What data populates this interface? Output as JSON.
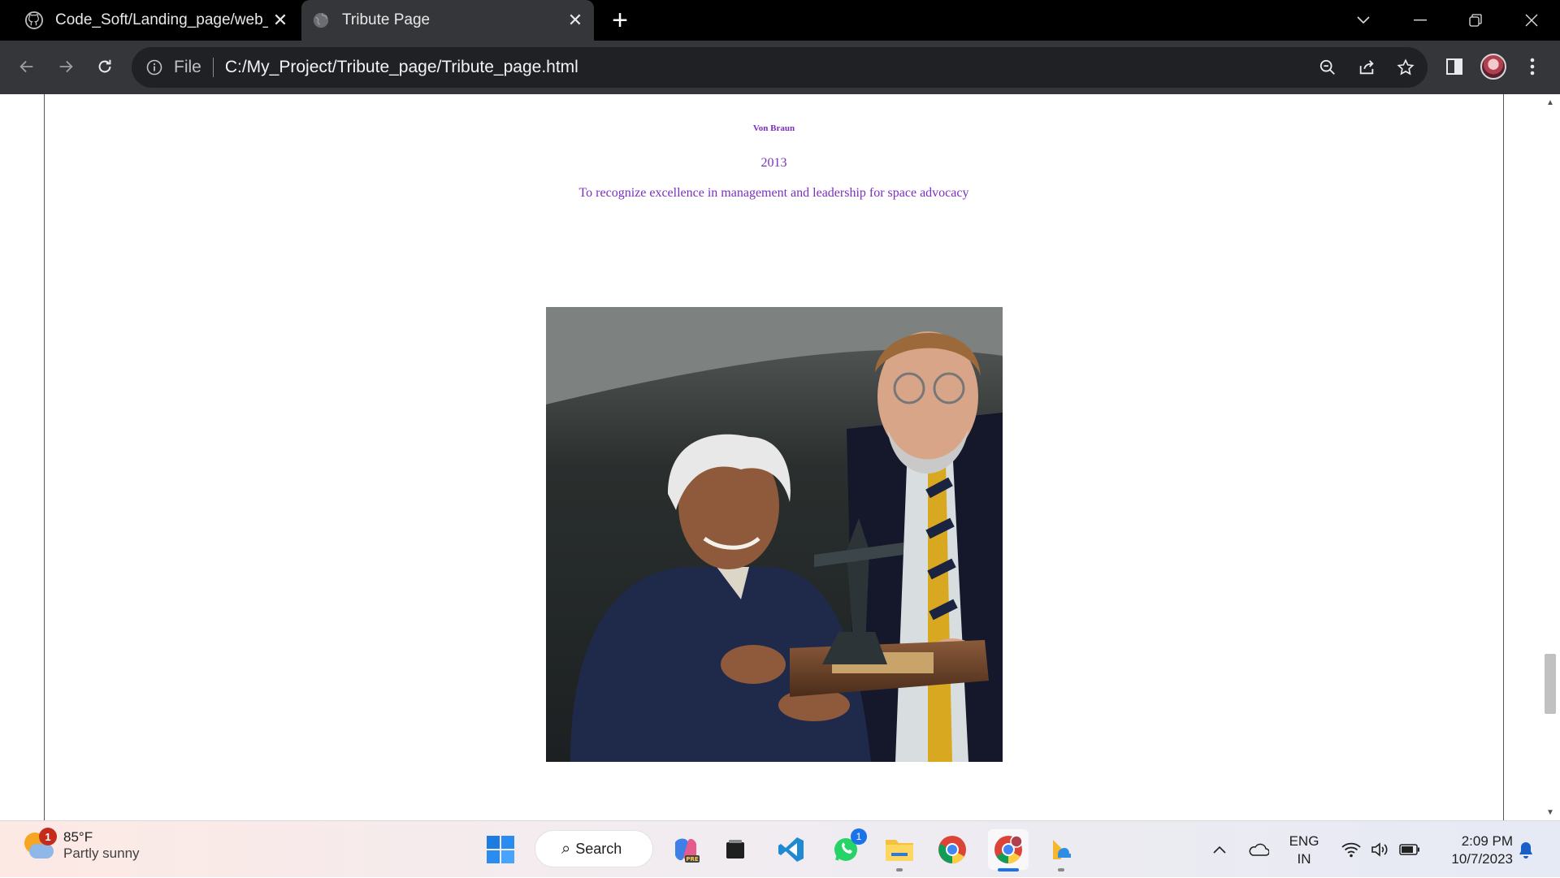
{
  "browser": {
    "tabs": [
      {
        "title": "Code_Soft/Landing_page/web_",
        "icon": "github-icon",
        "active": false
      },
      {
        "title": "Tribute Page",
        "icon": "globe-icon",
        "active": true
      }
    ],
    "omnibox": {
      "scheme_label": "File",
      "url": "C:/My_Project/Tribute_page/Tribute_page.html"
    }
  },
  "page": {
    "award_name": "Von Braun",
    "award_year": "2013",
    "award_description": "To recognize excellence in management and leadership for space advocacy",
    "text_color": "#7b2fbe",
    "photo_alt": "photo of award presentation"
  },
  "taskbar": {
    "weather": {
      "temperature": "85°F",
      "condition": "Partly sunny",
      "badge_count": "1"
    },
    "search_label": "Search",
    "whatsapp_badge": "1",
    "language": {
      "line1": "ENG",
      "line2": "IN"
    },
    "clock": {
      "time": "2:09 PM",
      "date": "10/7/2023"
    }
  }
}
